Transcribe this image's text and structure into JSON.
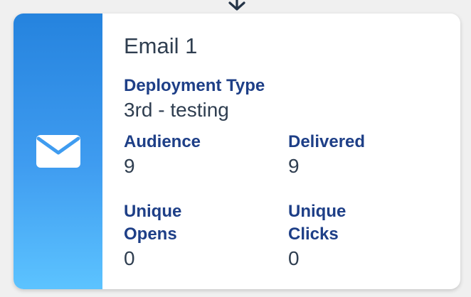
{
  "icons": {
    "connector": "arrow-down-icon",
    "channel": "envelope-icon"
  },
  "colors": {
    "label": "#1e3f87",
    "text": "#2f3e50",
    "side_top": "#2583de",
    "side_bottom": "#5cc3ff"
  },
  "card": {
    "title": "Email 1",
    "deployment_type": {
      "label": "Deployment Type",
      "value": "3rd - testing"
    },
    "audience": {
      "label": "Audience",
      "value": "9"
    },
    "delivered": {
      "label": "Delivered",
      "value": "9"
    },
    "unique_opens": {
      "label_line1": "Unique",
      "label_line2": "Opens",
      "value": "0"
    },
    "unique_clicks": {
      "label_line1": "Unique",
      "label_line2": "Clicks",
      "value": "0"
    }
  }
}
